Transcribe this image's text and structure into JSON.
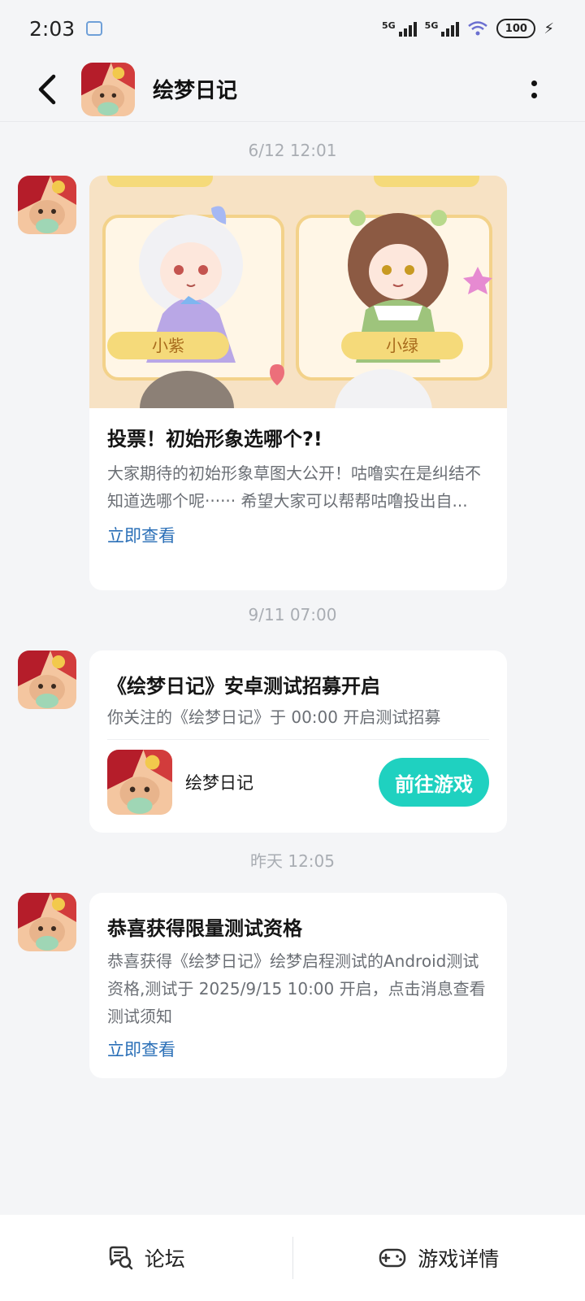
{
  "status_bar": {
    "time": "2:03",
    "network_1": "5G",
    "network_2": "5G",
    "battery": "100"
  },
  "header": {
    "title": "绘梦日记"
  },
  "messages": [
    {
      "timestamp": "6/12  12:01",
      "title": "投票！初始形象选哪个?!",
      "body": "大家期待的初始形象草图大公开！咕噜实在是纠结不知道选哪个呢······ 希望大家可以帮帮咕噜投出自...",
      "link": "立即查看",
      "hero_labels": [
        "小紫",
        "小绿"
      ]
    },
    {
      "timestamp": "9/11  07:00",
      "title": "《绘梦日记》安卓测试招募开启",
      "body": "你关注的《绘梦日记》于 00:00 开启测试招募",
      "game_name": "绘梦日记",
      "button": "前往游戏"
    },
    {
      "timestamp": "昨天  12:05",
      "title": "恭喜获得限量测试资格",
      "body": "恭喜获得《绘梦日记》绘梦启程测试的Android测试资格,测试于 2025/9/15 10:00 开启，点击消息查看测试须知",
      "link": "立即查看"
    }
  ],
  "bottom_bar": {
    "forum": "论坛",
    "game_details": "游戏详情"
  },
  "colors": {
    "accent_button": "#1fd1c0",
    "link": "#2a6fb7",
    "background": "#f4f5f7"
  }
}
